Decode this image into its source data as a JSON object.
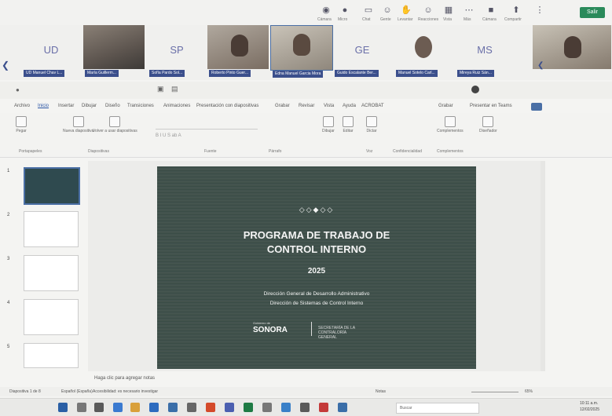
{
  "toolbar": {
    "items": [
      "Cámara",
      "Micro",
      "Chat",
      "Gente",
      "Levantar",
      "Reacciones",
      "Vista",
      "Más",
      "Cámara",
      "Compartir",
      "Salir"
    ]
  },
  "participants": [
    {
      "initials": "UD",
      "name": "UD Manuel Chav L..."
    },
    {
      "initials": "",
      "name": "María Guillerm..."
    },
    {
      "initials": "SP",
      "name": "Sofía Pardo Sol..."
    },
    {
      "initials": "",
      "name": "Roberto Pinto Guer..."
    },
    {
      "initials": "",
      "name": "Edna Manuel Garcia Mora"
    },
    {
      "initials": "GE",
      "name": "Guido Escalante Ber..."
    },
    {
      "initials": "",
      "name": "Manuel Sotelo Carl..."
    },
    {
      "initials": "MS",
      "name": "Mireya Ruiz Sán..."
    },
    {
      "initials": "",
      "name": ""
    }
  ],
  "ribbon": {
    "tabs": [
      "Archivo",
      "Inicio",
      "Insertar",
      "Dibujar",
      "Diseño",
      "Transiciones",
      "Animaciones",
      "Presentación con diapositivas",
      "Grabar",
      "Revisar",
      "Vista",
      "Ayuda",
      "ACROBAT",
      "Grabar",
      "Presentar en Teams"
    ],
    "active_tab": "Inicio",
    "buttons": [
      "Pegar",
      "Nueva diapositiva",
      "Volver a usar diapositivas",
      "Dibujar",
      "Editar",
      "Dictar",
      "Complementos",
      "Diseñador"
    ],
    "groups": [
      "Portapapeles",
      "Diapositivas",
      "Fuente",
      "Párrafo",
      "Voz",
      "Confidencialidad",
      "Complementos"
    ]
  },
  "thumbnails": [
    {
      "num": "1"
    },
    {
      "num": "2"
    },
    {
      "num": "3"
    },
    {
      "num": "4"
    },
    {
      "num": "5"
    }
  ],
  "slide": {
    "ornament": "◇◇◆◇◇",
    "title_line1": "PROGRAMA DE TRABAJO  DE",
    "title_line2": "CONTROL INTERNO",
    "year": "2025",
    "line1": "Dirección General de Desarrollo Administrativo",
    "line2": "Dirección de Sistemas de Control Interno",
    "gov_small": "Gobierno de",
    "gov": "SONORA",
    "org": "SECRETARÍA DE LA CONTRALORÍA GENERAL"
  },
  "notes": {
    "placeholder": "Haga clic para agregar notas"
  },
  "status": {
    "slide_info": "Diapositiva 1 de 8",
    "language": "Español (España)",
    "accessibility": "Accesibilidad: es necesario investigar",
    "notes_btn": "Notas",
    "zoom": "65%"
  },
  "taskbar": {
    "search": "Buscar",
    "time": "10:11 a.m.",
    "date": "12/02/2025"
  }
}
